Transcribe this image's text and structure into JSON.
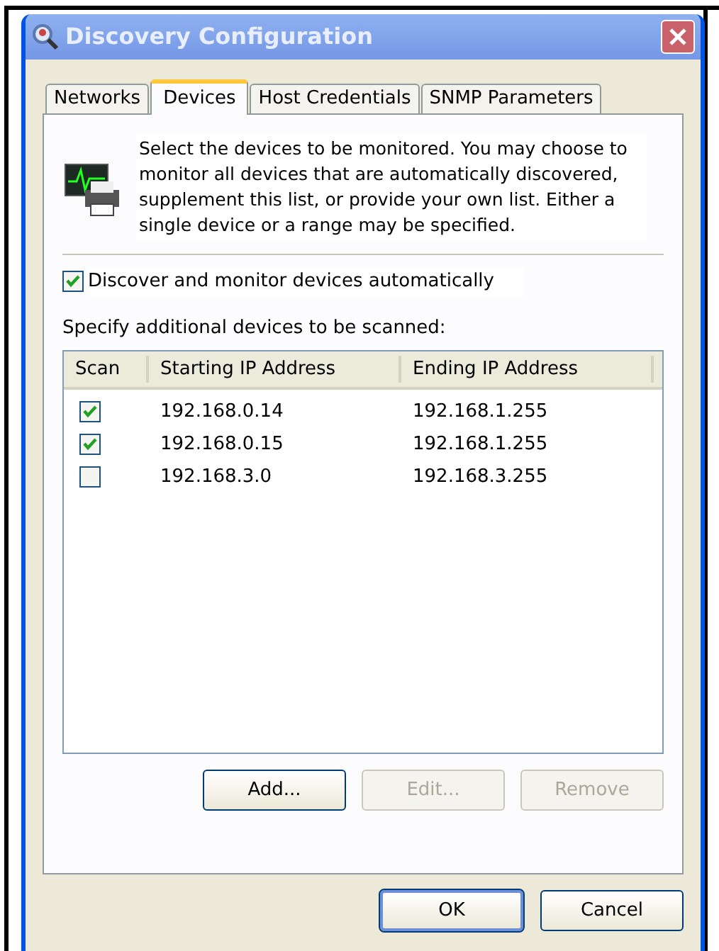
{
  "window": {
    "title": "Discovery Configuration"
  },
  "tabs": [
    {
      "label": "Networks",
      "selected": false
    },
    {
      "label": "Devices",
      "selected": true
    },
    {
      "label": "Host Credentials",
      "selected": false
    },
    {
      "label": "SNMP Parameters",
      "selected": false
    }
  ],
  "intro": "Select the devices to be monitored.  You may choose to monitor all devices that are automatically discovered,  supplement this list, or provide your own list.   Either a single device or a range may be specified.",
  "auto_discover": {
    "label": "Discover and monitor devices automatically",
    "checked": true
  },
  "list_label": "Specify additional devices to be scanned:",
  "table": {
    "columns": [
      "Scan",
      "Starting IP Address",
      "Ending IP Address"
    ],
    "rows": [
      {
        "checked": true,
        "start": "192.168.0.14",
        "end": "192.168.1.255"
      },
      {
        "checked": true,
        "start": "192.168.0.15",
        "end": "192.168.1.255"
      },
      {
        "checked": false,
        "start": "192.168.3.0",
        "end": "192.168.3.255"
      }
    ]
  },
  "list_buttons": [
    {
      "label": "Add...",
      "disabled": false
    },
    {
      "label": "Edit...",
      "disabled": true
    },
    {
      "label": "Remove",
      "disabled": true
    }
  ],
  "buttons": [
    "OK",
    "Cancel"
  ]
}
